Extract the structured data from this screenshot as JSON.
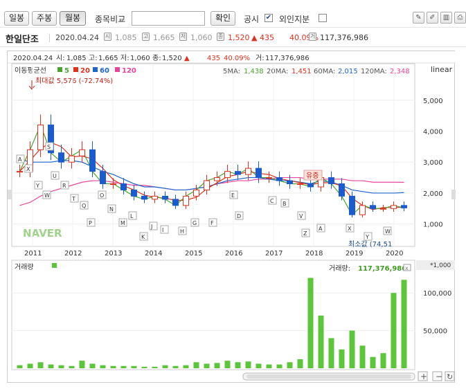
{
  "toolbar": {
    "tab_day": "일봉",
    "tab_week": "주봉",
    "tab_month": "월봉",
    "compare_label": "종목비교",
    "compare_value": "",
    "confirm_label": "확인",
    "disclosure_label": "공시",
    "disclosure_checked": "✔",
    "foreign_label": "외인지분"
  },
  "stock": {
    "name": "한일단조",
    "date": "2020.04.24",
    "open": "1,085",
    "high": "1,665",
    "low": "1,060",
    "close": "1,520",
    "change": "▲ 435",
    "change_pct": "40.09%",
    "volume": "117,376,986",
    "icon_open": "시",
    "icon_high": "고",
    "icon_low": "저",
    "icon_close": "종",
    "icon_volume": "거"
  },
  "chart_header": {
    "date": "2020.04.24",
    "open_label": "시:",
    "open": "1,085",
    "high_label": "고:",
    "high": "1,665",
    "low_label": "저:",
    "low": "1,060",
    "close_label": "종:",
    "close": "1,520",
    "arrow": "▲",
    "change": "435",
    "change_pct": "40.09%",
    "volume_label": "거:",
    "volume": "117,376,986"
  },
  "legend": {
    "title": "이동평균선",
    "ma5": "5",
    "ma20": "20",
    "ma60": "60",
    "ma120": "120",
    "ma5_label": "5MA:",
    "ma5_value": "1,438",
    "ma20_label": "20MA:",
    "ma20_value": "1,451",
    "ma60_label": "60MA:",
    "ma60_value": "2,015",
    "ma120_label": "120MA:",
    "ma120_value": "2,348",
    "scale": "linear",
    "max_label": "최대값 5,576 (-72.74%)",
    "min_label": "최소값",
    "min_value": "(74,51",
    "event_label": "유증",
    "brand": "NAVER"
  },
  "colors": {
    "up": "#e0301e",
    "down": "#1a5bd0",
    "ma5": "#4aa52e",
    "ma20": "#e0301e",
    "ma60": "#1a66cc",
    "ma120": "#e8449a",
    "volume": "#5cc63a"
  },
  "price_axis": [
    "5,000",
    "4,000",
    "3,000",
    "2,000",
    "1,000"
  ],
  "years": [
    "2011",
    "2012",
    "2013",
    "2014",
    "2015",
    "2016",
    "2017",
    "2018",
    "2019",
    "2020"
  ],
  "volume_panel": {
    "title": "거래량",
    "label": "거래량:",
    "value": "117,376,986",
    "unit": "*1,000",
    "axis": [
      "100,000",
      "50,000"
    ]
  },
  "markers": [
    "A",
    "X",
    "Y",
    "W",
    "S",
    "U",
    "R",
    "T",
    "Q",
    "P",
    "O",
    "N",
    "M",
    "L",
    "K",
    "J",
    "I",
    "H",
    "G",
    "F",
    "E",
    "D",
    "C",
    "B",
    "V",
    "Z"
  ],
  "chart_data": {
    "type": "candlestick",
    "title": "한일단조",
    "x": [
      "2011-01",
      "2011-04",
      "2011-07",
      "2011-10",
      "2012-01",
      "2012-04",
      "2012-07",
      "2012-10",
      "2013-01",
      "2013-04",
      "2013-07",
      "2013-10",
      "2014-01",
      "2014-04",
      "2014-07",
      "2014-10",
      "2015-01",
      "2015-04",
      "2015-07",
      "2015-10",
      "2016-01",
      "2016-04",
      "2016-07",
      "2016-10",
      "2017-01",
      "2017-04",
      "2017-07",
      "2017-10",
      "2018-01",
      "2018-04",
      "2018-07",
      "2018-10",
      "2019-01",
      "2019-04",
      "2019-07",
      "2019-10",
      "2020-01",
      "2020-04"
    ],
    "close": [
      2700,
      3400,
      4200,
      3300,
      3000,
      3200,
      3400,
      2700,
      2300,
      2300,
      2100,
      1900,
      1800,
      1900,
      1800,
      1600,
      1900,
      2100,
      2400,
      2500,
      2700,
      2600,
      2800,
      2500,
      2500,
      2400,
      2300,
      2300,
      2200,
      2500,
      2300,
      1900,
      1300,
      1600,
      1500,
      1500,
      1600,
      1520
    ],
    "ma60": [
      3100,
      3000,
      3000,
      3000,
      3050,
      3050,
      3000,
      2850,
      2700,
      2600,
      2450,
      2300,
      2200,
      2200,
      2150,
      2100,
      2100,
      2150,
      2200,
      2300,
      2400,
      2450,
      2500,
      2500,
      2450,
      2400,
      2400,
      2350,
      2300,
      2400,
      2350,
      2250,
      2100,
      2050,
      2000,
      2000,
      2000,
      2015
    ],
    "ma120": [
      1600,
      1700,
      1900,
      2050,
      2150,
      2250,
      2350,
      2400,
      2400,
      2350,
      2300,
      2250,
      2250,
      2200,
      2150,
      2100,
      2100,
      2150,
      2200,
      2300,
      2350,
      2400,
      2400,
      2450,
      2450,
      2500,
      2500,
      2500,
      2450,
      2450,
      2450,
      2450,
      2400,
      2400,
      2350,
      2350,
      2350,
      2348
    ],
    "volume": [
      4000,
      6000,
      8000,
      5000,
      4000,
      3000,
      10000,
      6000,
      4000,
      3000,
      3000,
      3000,
      2000,
      2000,
      4000,
      3000,
      4000,
      8000,
      6000,
      7000,
      10000,
      8000,
      9000,
      6000,
      5000,
      5000,
      8000,
      12000,
      120000,
      70000,
      40000,
      25000,
      50000,
      30000,
      15000,
      20000,
      100000,
      117377
    ],
    "ylim": [
      500,
      5800
    ],
    "volume_ylim": [
      0,
      125000
    ]
  }
}
